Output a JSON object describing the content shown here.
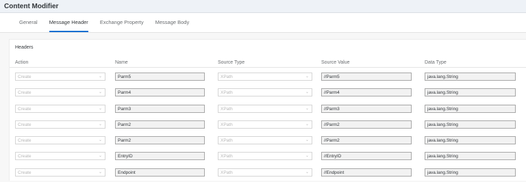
{
  "app": {
    "title": "Content Modifier"
  },
  "tabs": [
    {
      "label": "General",
      "active": false
    },
    {
      "label": "Message Header",
      "active": true
    },
    {
      "label": "Exchange Property",
      "active": false
    },
    {
      "label": "Message Body",
      "active": false
    }
  ],
  "headers_section": {
    "title": "Headers",
    "columns": [
      "Action",
      "Name",
      "Source Type",
      "Source Value",
      "Data Type"
    ],
    "rows": [
      {
        "action": "Create",
        "name": "Parm5",
        "source_type": "XPath",
        "source_value": "//Parm5",
        "data_type": "java.lang.String"
      },
      {
        "action": "Create",
        "name": "Parm4",
        "source_type": "XPath",
        "source_value": "//Parm4",
        "data_type": "java.lang.String"
      },
      {
        "action": "Create",
        "name": "Parm3",
        "source_type": "XPath",
        "source_value": "//Parm3",
        "data_type": "java.lang.String"
      },
      {
        "action": "Create",
        "name": "Parm2",
        "source_type": "XPath",
        "source_value": "//Parm2",
        "data_type": "java.lang.String"
      },
      {
        "action": "Create",
        "name": "Parm2",
        "source_type": "XPath",
        "source_value": "//Parm2",
        "data_type": "java.lang.String"
      },
      {
        "action": "Create",
        "name": "EntryID",
        "source_type": "XPath",
        "source_value": "//EntryID",
        "data_type": "java.lang.String"
      },
      {
        "action": "Create",
        "name": "Endpoint",
        "source_type": "XPath",
        "source_value": "//Endpoint",
        "data_type": "java.lang.String"
      }
    ]
  }
}
